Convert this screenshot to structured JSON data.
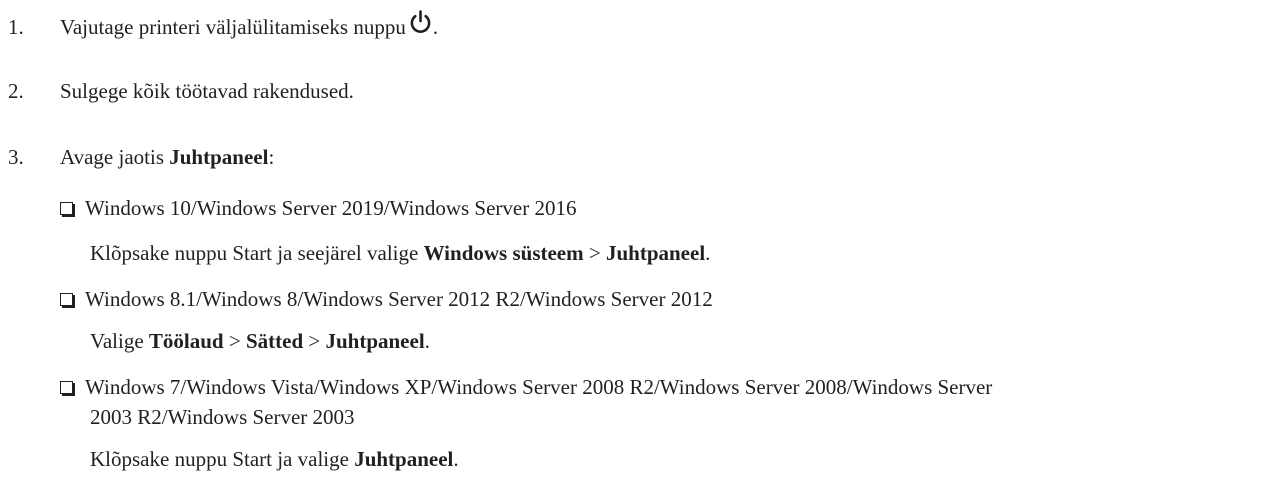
{
  "steps": [
    {
      "num": "1.",
      "text": "Vajutage printeri väljalülitamiseks nuppu",
      "icon": "power-icon",
      "after": "."
    },
    {
      "num": "2.",
      "text": "Sulgege kõik töötavad rakendused."
    },
    {
      "num": "3.",
      "text_before": "Avage jaotis ",
      "bold": "Juhtpaneel",
      "after": ":"
    }
  ],
  "options": [
    {
      "label": "Windows 10/Windows Server 2019/Windows Server 2016",
      "detail_before": "Klõpsake nuppu Start ja seejärel valige ",
      "detail_bold1": "Windows süsteem",
      "detail_sep": " > ",
      "detail_bold2": "Juhtpaneel",
      "detail_after": "."
    },
    {
      "label": "Windows 8.1/Windows 8/Windows Server 2012 R2/Windows Server 2012",
      "detail_before": "Valige ",
      "detail_bold1": "Töölaud",
      "detail_sep1": " > ",
      "detail_bold2": "Sätted",
      "detail_sep2": " > ",
      "detail_bold3": "Juhtpaneel",
      "detail_after": "."
    },
    {
      "label_line1": "Windows 7/Windows Vista/Windows XP/Windows Server 2008 R2/Windows Server 2008/Windows Server",
      "label_line2": "2003 R2/Windows Server 2003",
      "detail_before": "Klõpsake nuppu Start ja valige ",
      "detail_bold": "Juhtpaneel",
      "detail_after": "."
    }
  ]
}
